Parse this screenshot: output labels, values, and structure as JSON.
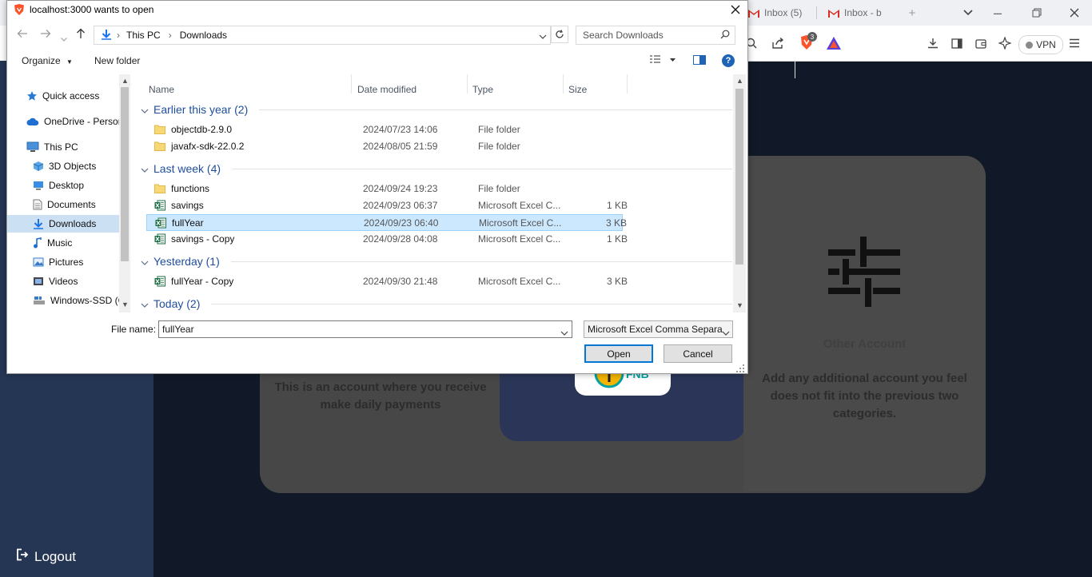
{
  "browser": {
    "tabs": [
      {
        "label": "Inbox (5)"
      },
      {
        "label": "Inbox - b"
      }
    ],
    "vpn_label": "VPN",
    "brave_badge": "3"
  },
  "page": {
    "logout_label": "Logout",
    "card_left_text": "This is an account where you receive make daily payments",
    "card_right_text": "Add any additional account you feel does not fit into the previous two categories.",
    "card_right_heading": "Other Account",
    "fnb_label": "FNB"
  },
  "dialog": {
    "title": "localhost:3000 wants to open",
    "breadcrumb": [
      "This PC",
      "Downloads"
    ],
    "search_placeholder": "Search Downloads",
    "organize_label": "Organize",
    "new_folder_label": "New folder",
    "nav_items": [
      {
        "label": "Quick access",
        "icon": "star-icon"
      },
      {
        "label": "OneDrive - Persor",
        "icon": "cloud-icon"
      },
      {
        "label": "This PC",
        "icon": "computer-icon"
      },
      {
        "label": "3D Objects",
        "icon": "cube-icon"
      },
      {
        "label": "Desktop",
        "icon": "desktop-icon"
      },
      {
        "label": "Documents",
        "icon": "document-icon"
      },
      {
        "label": "Downloads",
        "icon": "download-icon",
        "selected": true
      },
      {
        "label": "Music",
        "icon": "music-icon"
      },
      {
        "label": "Pictures",
        "icon": "picture-icon"
      },
      {
        "label": "Videos",
        "icon": "video-icon"
      },
      {
        "label": "Windows-SSD (C",
        "icon": "drive-icon"
      }
    ],
    "columns": [
      "Name",
      "Date modified",
      "Type",
      "Size"
    ],
    "groups": [
      {
        "label": "Earlier this year (2)"
      },
      {
        "label": "Last week (4)"
      },
      {
        "label": "Yesterday (1)"
      },
      {
        "label": "Today (2)"
      }
    ],
    "files": [
      {
        "name": "objectdb-2.9.0",
        "date": "2024/07/23 14:06",
        "type": "File folder",
        "size": "",
        "kind": "folder"
      },
      {
        "name": "javafx-sdk-22.0.2",
        "date": "2024/08/05 21:59",
        "type": "File folder",
        "size": "",
        "kind": "folder"
      },
      {
        "name": "functions",
        "date": "2024/09/24 19:23",
        "type": "File folder",
        "size": "",
        "kind": "folder"
      },
      {
        "name": "savings",
        "date": "2024/09/23 06:37",
        "type": "Microsoft Excel C...",
        "size": "1 KB",
        "kind": "excel"
      },
      {
        "name": "fullYear",
        "date": "2024/09/23 06:40",
        "type": "Microsoft Excel C...",
        "size": "3 KB",
        "kind": "excel",
        "selected": true
      },
      {
        "name": "savings - Copy",
        "date": "2024/09/28 04:08",
        "type": "Microsoft Excel C...",
        "size": "1 KB",
        "kind": "excel"
      },
      {
        "name": "fullYear - Copy",
        "date": "2024/09/30 21:48",
        "type": "Microsoft Excel C...",
        "size": "3 KB",
        "kind": "excel"
      }
    ],
    "file_name_label": "File name:",
    "file_name_value": "fullYear",
    "file_type_value": "Microsoft Excel Comma Separa",
    "open_label": "Open",
    "cancel_label": "Cancel"
  }
}
